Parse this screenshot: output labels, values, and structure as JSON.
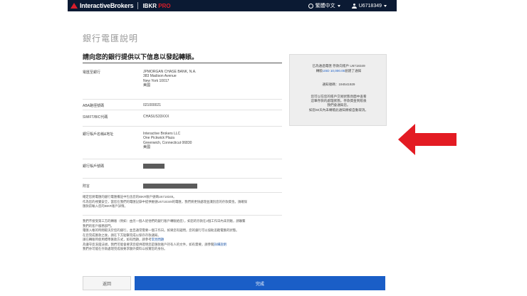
{
  "header": {
    "brand": "InteractiveBrokers",
    "product_prefix": "IBKR ",
    "product_suffix": "PRO",
    "language": "繁體中文",
    "username": "U6718349"
  },
  "page": {
    "title": "銀行電匯說明",
    "subtitle": "請向您的銀行提供以下信息以發起轉賬。"
  },
  "details": {
    "bank_label": "電匯至銀行",
    "bank_lines": [
      "JPMORGAN CHASE BANK, N.A.",
      "383 Madison Avenue",
      "New York 10017",
      "美國"
    ],
    "aba_label": "ABA路徑號碼",
    "aba_value": "021000021",
    "swift_label": "SWIFT/BIC代碼",
    "swift_value": "CHASUS33XXX",
    "beneficiary_label": "銀行賬戶名稱&地址",
    "beneficiary_lines": [
      "Interactive Brokers LLC",
      "One Pickwick Plaza",
      "Greenwich, Connecticut 06830",
      "美國"
    ],
    "account_label": "銀行賬戶號碼",
    "memo_label": "附言"
  },
  "notes": {
    "p1_line1": "確定您將電匯的銀行電匯備註中包含您的IBKR賬戶號碼U6718349。",
    "p1_line2": "作為您的視覺安全，當您在我們的電匯記錄中提供帳號U6718349的電匯，我們將更快處理並識別您的存款資金。請確保",
    "p1_line3": "匯款前輸入您的IBKR賬戶詳情。",
    "p2_line1": "我們不接受第三方的轉賬（例如：由另一個人從他們的銀行賬戶轉賬給您），如您的存款在2個工作日內未到賬，請聯繫",
    "p2_line2": "我們的客戶服務部門。",
    "p2_line3": "電匯入帳的時間取決於您的銀行，並且通常需要一個工作日。如果您有疑問，您的銀行可以協助追蹤電匯的狀態。",
    "p2_line4": "在您完成匯款之後，請在下方點擊完成以保存存款通知。",
    "p2_line5": "請在轉賬時使用標準匯款方式，如有問題，請參考",
    "p2_link": "常見問題",
    "p2_line6": "為遵守反洗錢法規，我們可能會要求您提供證明您是匯款賬戶持有人的文件，如有需要，請參閱",
    "p2_link2": "詳細說明",
    "p2_line7": "我們亦可能在存款處理完成後要求額外資料以核實您的身份。"
  },
  "actions": {
    "back_label": "返回",
    "done_label": "完成"
  },
  "side_card": {
    "line1": "已為通過電匯 存款向賬戶 U6718349",
    "line2_prefix": "轉賬",
    "amount": "USD 10,000.00",
    "line2_suffix": "創建了通知",
    "notice_no": "通知號碼：194541929",
    "body1": "您可以在您的賬戶交易狀態頁面中查看",
    "body2": "這筆存款的處理狀態，存款資金到賬後",
    "body3": "我們會通知您。",
    "body4": "如您60天內未轉賬此通知將被自動取消。"
  }
}
